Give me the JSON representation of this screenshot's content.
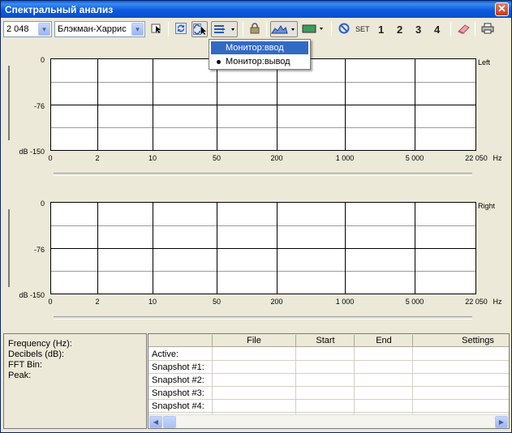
{
  "window": {
    "title": "Спектральный анализ",
    "close_glyph": "✕"
  },
  "toolbar": {
    "fft_size": "2 048",
    "window_function": "Блэкман-Харрис",
    "combo_arrow": "▾",
    "set_label": "SET",
    "snapshot_buttons": [
      "1",
      "2",
      "3",
      "4"
    ],
    "icons": [
      "select-arrow-icon",
      "refresh-icon",
      "monitor-mode-icon",
      "monitor-dropdown-icon",
      "lock-icon",
      "spectrum-view-icon",
      "color-swatch-icon",
      "clear-icon",
      "eraser-icon",
      "print-icon"
    ],
    "color_swatch": "#3c9b5f"
  },
  "monitor_menu": {
    "items": [
      {
        "label": "Монитор:ввод",
        "highlighted": true,
        "checked": false
      },
      {
        "label": "Монитор:вывод",
        "highlighted": false,
        "checked": true
      }
    ]
  },
  "charts": [
    {
      "channel": "Left",
      "y_ticks": [
        "0",
        "-76",
        "dB -150"
      ],
      "x_ticks": [
        "0",
        "2",
        "10",
        "50",
        "200",
        "1 000",
        "5 000",
        "22 050"
      ],
      "x_unit": "Hz"
    },
    {
      "channel": "Right",
      "y_ticks": [
        "0",
        "-76",
        "dB -150"
      ],
      "x_ticks": [
        "0",
        "2",
        "10",
        "50",
        "200",
        "1 000",
        "5 000",
        "22 050"
      ],
      "x_unit": "Hz"
    }
  ],
  "info": {
    "lines": [
      "Frequency (Hz):",
      "Decibels (dB):",
      "FFT Bin:",
      "Peak:"
    ]
  },
  "table": {
    "columns": [
      "File",
      "Start",
      "End",
      "Settings"
    ],
    "rows": [
      "Active:",
      "Snapshot #1:",
      "Snapshot #2:",
      "Snapshot #3:",
      "Snapshot #4:"
    ]
  },
  "scrollbar": {
    "left_glyph": "◀",
    "right_glyph": "▶"
  }
}
